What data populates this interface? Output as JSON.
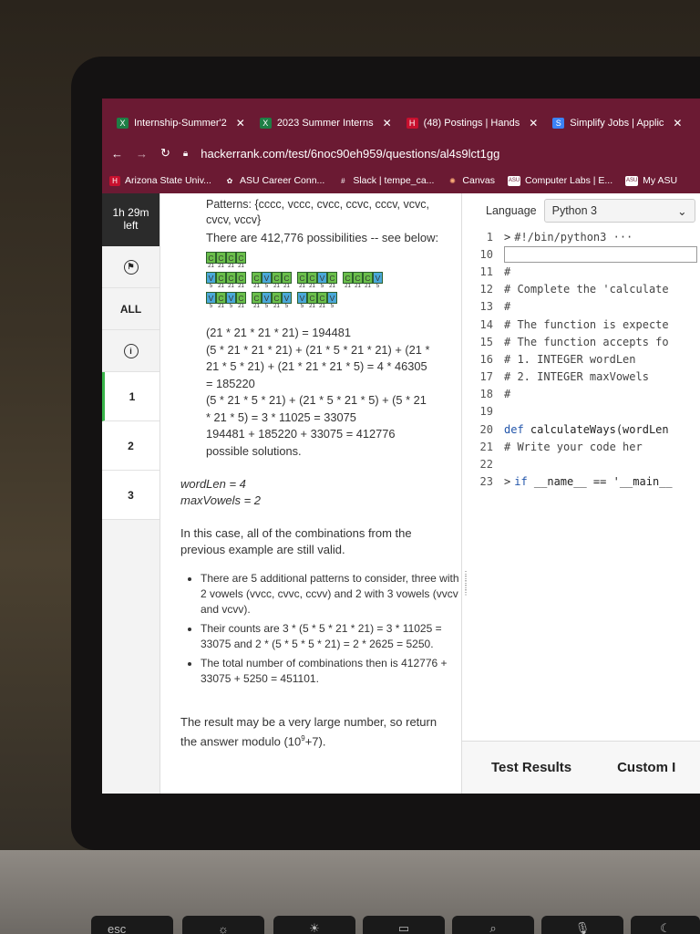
{
  "browser": {
    "tabs": [
      {
        "title": "Internship-Summer'2",
        "favicon_color": "#1e7e45",
        "favicon_text": "X"
      },
      {
        "title": "2023 Summer Interns",
        "favicon_color": "#1e7e45",
        "favicon_text": "X"
      },
      {
        "title": "(48) Postings | Hands",
        "favicon_color": "#c8102e",
        "favicon_text": "H"
      },
      {
        "title": "Simplify Jobs | Applic",
        "favicon_color": "#3b82f6",
        "favicon_text": "S"
      }
    ],
    "url": "hackerrank.com/test/6noc90eh959/questions/al4s9lct1gg",
    "bookmarks": [
      {
        "label": "Arizona State Univ...",
        "favicon_text": "H",
        "favicon_color": "#c8102e"
      },
      {
        "label": "ASU Career Conn...",
        "favicon_text": "✿",
        "favicon_color": "#ffffff"
      },
      {
        "label": "Slack | tempe_ca...",
        "favicon_text": "#",
        "favicon_color": "#e01e5a"
      },
      {
        "label": "Canvas",
        "favicon_text": "✺",
        "favicon_color": "#e66000"
      },
      {
        "label": "Computer Labs | E...",
        "favicon_text": "ASU",
        "favicon_color": "#ffffff"
      },
      {
        "label": "My ASU",
        "favicon_text": "ASU",
        "favicon_color": "#ffffff"
      }
    ]
  },
  "sidebar": {
    "timer": "1h 29m left",
    "timer_line1": "1h 29m",
    "timer_line2": "left",
    "all_label": "ALL",
    "info_icon_text": "i",
    "questions": [
      "1",
      "2",
      "3"
    ]
  },
  "problem": {
    "patterns_intro": "Patterns: {cccc, vccc, cvcc, ccvc, cccv, vcvc, cvcv, vccv}",
    "possibilities": "There are 412,776 possibilities -- see below:",
    "pattern_rows": [
      [
        {
          "letters": [
            "C",
            "C",
            "C",
            "C"
          ],
          "nums": [
            "21",
            "21",
            "21",
            "21"
          ]
        }
      ],
      [
        {
          "letters": [
            "V",
            "C",
            "C",
            "C"
          ],
          "nums": [
            "5",
            "21",
            "21",
            "21"
          ]
        },
        {
          "letters": [
            "C",
            "V",
            "C",
            "C"
          ],
          "nums": [
            "21",
            "5",
            "21",
            "21"
          ]
        },
        {
          "letters": [
            "C",
            "C",
            "V",
            "C"
          ],
          "nums": [
            "21",
            "21",
            "5",
            "21"
          ]
        },
        {
          "letters": [
            "C",
            "C",
            "C",
            "V"
          ],
          "nums": [
            "21",
            "21",
            "21",
            "5"
          ]
        }
      ],
      [
        {
          "letters": [
            "V",
            "C",
            "V",
            "C"
          ],
          "nums": [
            "5",
            "21",
            "5",
            "21"
          ]
        },
        {
          "letters": [
            "C",
            "V",
            "C",
            "V"
          ],
          "nums": [
            "21",
            "5",
            "21",
            "5"
          ]
        },
        {
          "letters": [
            "V",
            "C",
            "C",
            "V"
          ],
          "nums": [
            "5",
            "21",
            "21",
            "5"
          ]
        }
      ]
    ],
    "math_lines": [
      "(21 * 21 * 21 * 21) = 194481",
      "(5 * 21 * 21 * 21) + (21 * 5 * 21 * 21) + (21 *",
      "21 * 5 * 21) + (21 * 21 * 21 * 5) = 4 * 46305",
      "= 185220",
      "(5 * 21 * 5 * 21) + (21 * 5 * 21 * 5) + (5 * 21",
      "* 21 * 5) = 3 * 11025 = 33075",
      "194481 + 185220 + 33075 = 412776",
      "possible solutions."
    ],
    "example_wordlen": "wordLen = 4",
    "example_maxvowels": "maxVowels = 2",
    "case_text": "In this case, all of the combinations from the previous example are still valid.",
    "bullets": [
      "There are 5 additional patterns to consider, three with 2 vowels (vvcc, cvvc, ccvv) and 2 with 3 vowels (vvcv and vcvv).",
      "Their counts are 3 * (5 * 5 * 21 * 21) = 3 * 11025 = 33075 and 2 * (5 * 5 * 5 * 21) = 2 * 2625 = 5250.",
      "The total number of combinations then is 412776 + 33075 + 5250 = 451101."
    ],
    "result_text": "The result may be a very large number, so return the answer modulo (10",
    "result_sup": "9",
    "result_tail": "+7)."
  },
  "editor": {
    "language_label": "Language",
    "language_value": "Python 3",
    "lines": [
      {
        "n": "1",
        "text": "#!/bin/python3 ···",
        "fold": true,
        "kind": "cm"
      },
      {
        "n": "10",
        "text": "",
        "kind": "cursor"
      },
      {
        "n": "11",
        "text": "#",
        "kind": "cm"
      },
      {
        "n": "12",
        "text": "# Complete the 'calculate",
        "kind": "cm"
      },
      {
        "n": "13",
        "text": "#",
        "kind": "cm"
      },
      {
        "n": "14",
        "text": "# The function is expecte",
        "kind": "cm"
      },
      {
        "n": "15",
        "text": "# The function accepts fo",
        "kind": "cm"
      },
      {
        "n": "16",
        "text": "#  1. INTEGER wordLen",
        "kind": "cm"
      },
      {
        "n": "17",
        "text": "#  2. INTEGER maxVowels",
        "kind": "cm"
      },
      {
        "n": "18",
        "text": "#",
        "kind": "cm"
      },
      {
        "n": "19",
        "text": "",
        "kind": "blank"
      },
      {
        "n": "20",
        "text": "def calculateWays(wordLen",
        "kind": "def"
      },
      {
        "n": "21",
        "text": "    # Write your code her",
        "kind": "cm"
      },
      {
        "n": "22",
        "text": "",
        "kind": "blank"
      },
      {
        "n": "23",
        "text": "if __name__ == '__main__",
        "fold": true,
        "kind": "main"
      }
    ],
    "test_results": "Test Results",
    "custom_input": "Custom I"
  },
  "keyboard": {
    "esc": "esc"
  }
}
